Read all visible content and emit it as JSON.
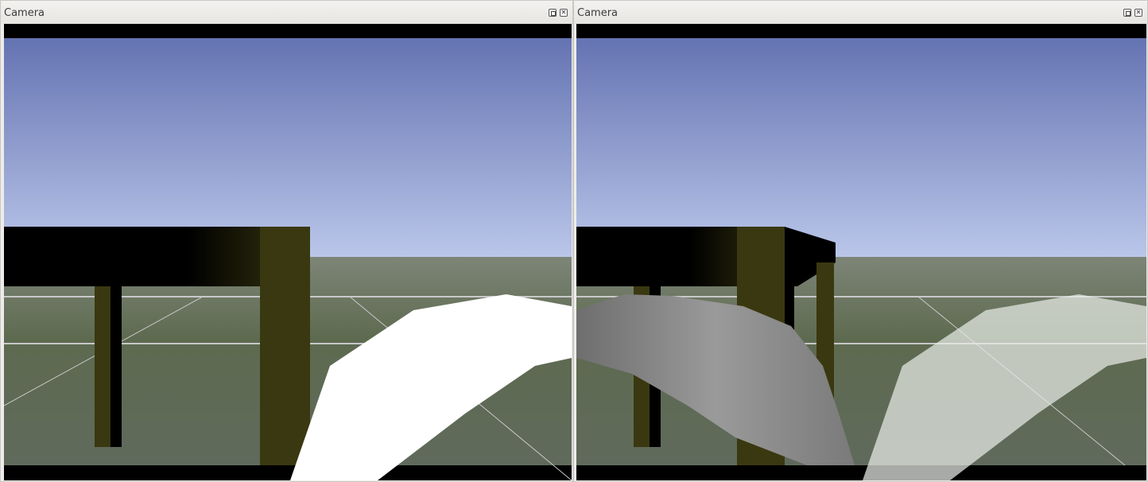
{
  "left_panel": {
    "title": "Camera",
    "float_icon": "float-window-icon",
    "close_icon": "close-window-icon"
  },
  "right_panel": {
    "title": "Camera",
    "float_icon": "float-window-icon",
    "close_icon": "close-window-icon"
  },
  "colors": {
    "sky_top": "#6070b0",
    "sky_bottom": "#b8c4e8",
    "ground": "#5a6450",
    "table_dark": "#000000",
    "table_olive": "#3a3810",
    "white_object": "#ffffff",
    "gray_object": "#7a7a7a"
  }
}
